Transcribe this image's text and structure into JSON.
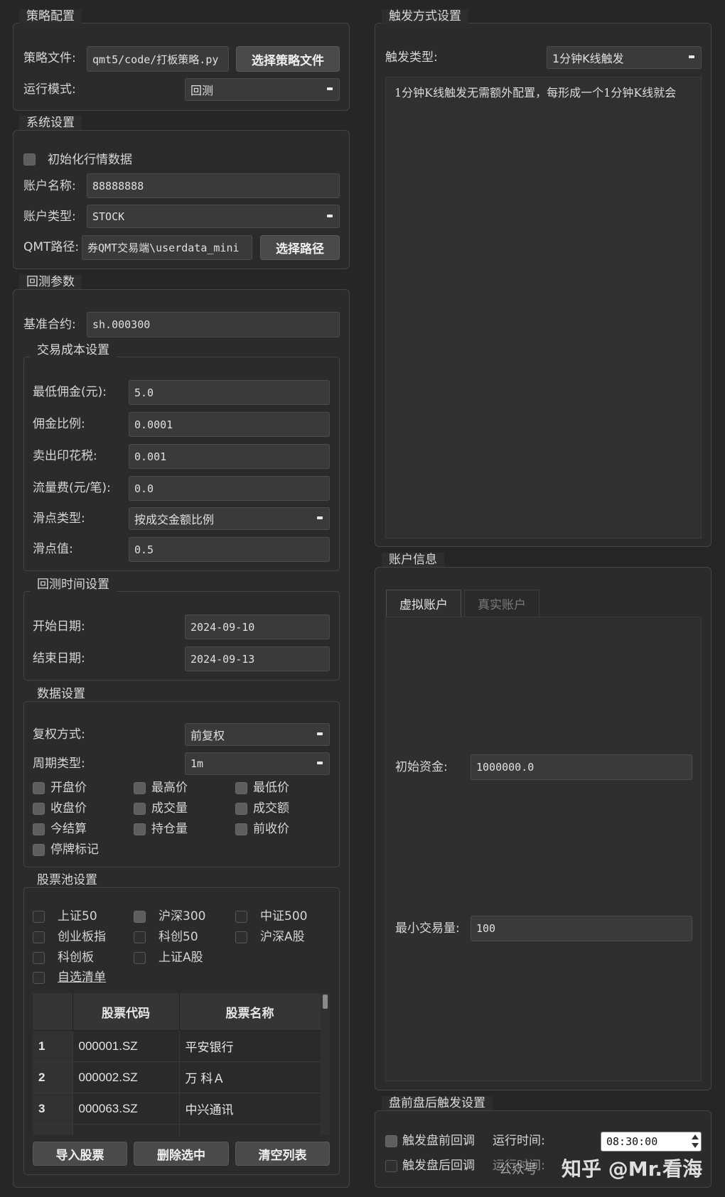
{
  "strategy": {
    "title": "策略配置",
    "file_label": "策略文件:",
    "file_value": "qmt5/code/打板策略.py",
    "choose_file": "选择策略文件",
    "mode_label": "运行模式:",
    "mode_value": "回测"
  },
  "system": {
    "title": "系统设置",
    "init_market": "初始化行情数据",
    "account_name_label": "账户名称:",
    "account_name": "88888888",
    "account_type_label": "账户类型:",
    "account_type": "STOCK",
    "qmt_path_label": "QMT路径:",
    "qmt_path": "券QMT交易端\\userdata_mini",
    "choose_path": "选择路径"
  },
  "backtest": {
    "title": "回测参数",
    "benchmark_label": "基准合约:",
    "benchmark": "sh.000300",
    "cost": {
      "title": "交易成本设置",
      "min_commission_label": "最低佣金(元):",
      "min_commission": "5.0",
      "commission_rate_label": "佣金比例:",
      "commission_rate": "0.0001",
      "stamp_tax_label": "卖出印花税:",
      "stamp_tax": "0.001",
      "flow_fee_label": "流量费(元/笔):",
      "flow_fee": "0.0",
      "slippage_type_label": "滑点类型:",
      "slippage_type": "按成交金额比例",
      "slippage_value_label": "滑点值:",
      "slippage_value": "0.5"
    },
    "time": {
      "title": "回测时间设置",
      "start_label": "开始日期:",
      "start": "2024-09-10",
      "end_label": "结束日期:",
      "end": "2024-09-13"
    },
    "data": {
      "title": "数据设置",
      "adjust_label": "复权方式:",
      "adjust": "前复权",
      "period_label": "周期类型:",
      "period": "1m",
      "fields": [
        "开盘价",
        "最高价",
        "最低价",
        "收盘价",
        "成交量",
        "成交额",
        "今结算",
        "持仓量",
        "前收价",
        "停牌标记"
      ]
    },
    "pool": {
      "title": "股票池设置",
      "options": [
        "上证50",
        "沪深300",
        "中证500",
        "创业板指",
        "科创50",
        "沪深A股",
        "科创板",
        "上证A股"
      ],
      "custom": "自选清单",
      "columns": [
        "股票代码",
        "股票名称"
      ],
      "rows": [
        {
          "idx": "1",
          "code": "000001.SZ",
          "name": "平安银行"
        },
        {
          "idx": "2",
          "code": "000002.SZ",
          "name": "万 科Ａ"
        },
        {
          "idx": "3",
          "code": "000063.SZ",
          "name": "中兴通讯"
        }
      ],
      "import_btn": "导入股票",
      "delete_btn": "删除选中",
      "clear_btn": "清空列表"
    }
  },
  "trigger": {
    "title": "触发方式设置",
    "type_label": "触发类型:",
    "type": "1分钟K线触发",
    "desc": "1分钟K线触发无需额外配置，每形成一个1分钟K线就会"
  },
  "account": {
    "title": "账户信息",
    "tab_virtual": "虚拟账户",
    "tab_real": "真实账户",
    "init_cash_label": "初始资金:",
    "init_cash": "1000000.0",
    "min_volume_label": "最小交易量:",
    "min_volume": "100"
  },
  "premarket": {
    "title": "盘前盘后触发设置",
    "pre_label": "触发盘前回调",
    "run_time_label": "运行时间:",
    "run_time": "08:30:00",
    "post_label": "触发盘后回调",
    "run_time_label2": "运行时间:"
  },
  "watermark": "知乎 @Mr.看海",
  "watermark_small": "公众号"
}
